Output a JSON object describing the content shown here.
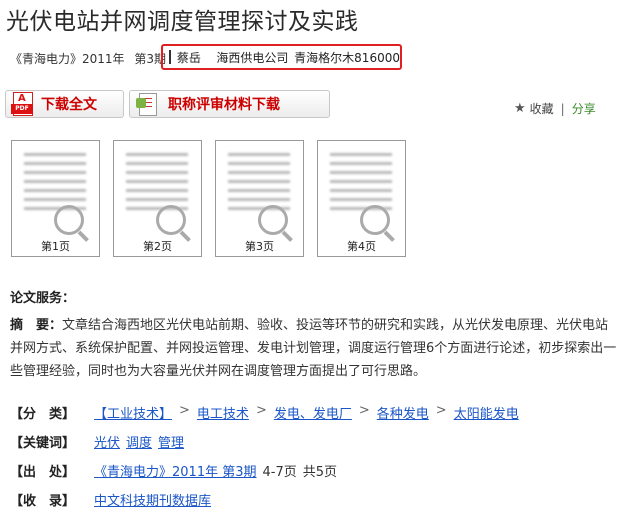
{
  "title": "光伏电站并网调度管理探讨及实践",
  "source": {
    "journal": "《青海电力》2011年",
    "issue": "第3期"
  },
  "author_box": {
    "author": "蔡岳",
    "org": "海西供电公司",
    "address": "青海格尔木816000"
  },
  "buttons": {
    "download": "下载全文",
    "pdf_badge": "PDF",
    "material": "职称评审材料下载"
  },
  "actions": {
    "favorite": "收藏",
    "divider": "|",
    "share": "分享"
  },
  "pages": [
    "第1页",
    "第2页",
    "第3页",
    "第4页"
  ],
  "service_heading": "论文服务：",
  "abstract": {
    "label": "摘　要：",
    "text": "文章结合海西地区光伏电站前期、验收、投运等环节的研究和实践，从光伏发电原理、光伏电站并网方式、系统保护配置、并网投运管理、发电计划管理，调度运行管理6个方面进行论述，初步探索出一些管理经验，同时也为大容量光伏并网在调度管理方面提出了可行思路。"
  },
  "classification": {
    "label": "【分　类】",
    "items": [
      "【工业技术】",
      "电工技术",
      "发电、发电厂",
      "各种发电",
      "太阳能发电"
    ],
    "separator": ">"
  },
  "keywords": {
    "label": "【关键词】",
    "items": [
      "光伏",
      "调度",
      "管理"
    ]
  },
  "origin": {
    "label": "【出　处】",
    "link": "《青海电力》2011年 第3期",
    "pages": "4-7页",
    "total": "共5页"
  },
  "database": {
    "label": "【收　录】",
    "link": "中文科技期刊数据库"
  }
}
